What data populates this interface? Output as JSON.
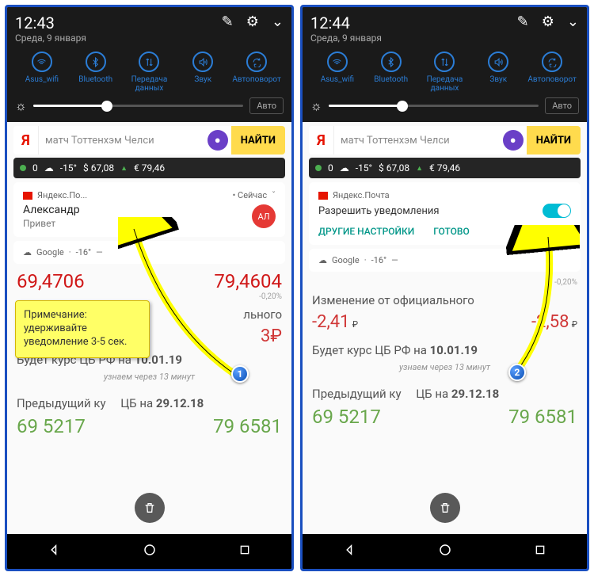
{
  "time1": "12:43",
  "time2": "12:44",
  "date": "Среда, 9 января",
  "qs": {
    "wifi": "Asus_wifi",
    "bt": "Bluetooth",
    "data": "Передача данных",
    "sound": "Звук",
    "rotate": "Автоповорот"
  },
  "auto": "Авто",
  "search": {
    "placeholder": "матч Тоттенхэм Челси",
    "find": "НАЙТИ"
  },
  "weather": {
    "count": "0",
    "temp": "-15°",
    "usd": "$ 67,08",
    "eur": "€ 79,46",
    "arrow": "▲"
  },
  "notif1": {
    "app": "Яндекс.По...",
    "time": "• Сейчас",
    "chev": "ˇ",
    "title": "Александр",
    "sub": "Привет",
    "avatar": "АЛ"
  },
  "notif2": {
    "app": "Яндекс.Почта",
    "allow": "Разрешить уведомления",
    "more": "ДРУГИЕ НАСТРОЙКИ",
    "done": "ГОТОВО"
  },
  "google": {
    "app": "Google",
    "temp": "-16°",
    "dash": "—"
  },
  "bg": {
    "big1": "69,4706",
    "big2": "79,4604",
    "delta": "-0,20%",
    "change_ru": "Изменение от официального",
    "change_ru_trunc": "льного",
    "r1": "-2,41",
    "r2": "-2,58",
    "rub_small": "₽",
    "big_trunc": "3₽",
    "cb": "Будет курс ЦБ РФ на",
    "cb_date": "10.01.19",
    "wait": "узнаем через 13 минут",
    "prev": "Предыдущий ку",
    "prev2": "ЦБ на",
    "prev_date": "29.12.18",
    "bot1": "69 5217",
    "bot2": "79 6581"
  },
  "callout": "Примечание: удерживайте уведомление 3-5 сек.",
  "badge1": "1",
  "badge2": "2"
}
